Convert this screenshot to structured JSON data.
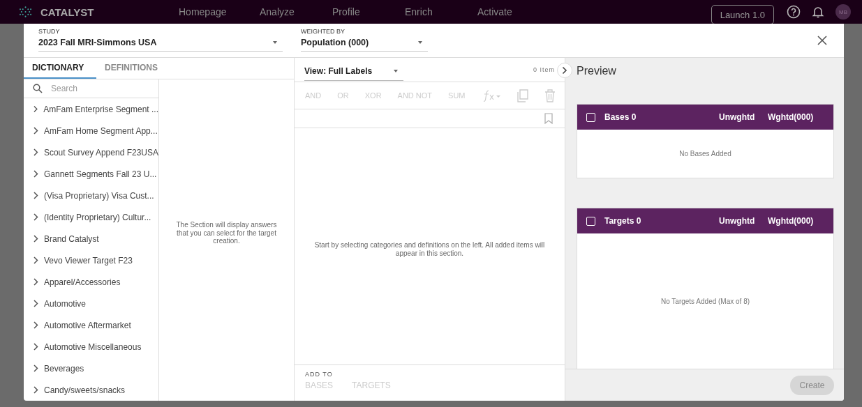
{
  "app": {
    "brand": "CATALYST"
  },
  "nav": [
    {
      "label": "Homepage"
    },
    {
      "label": "Analyze"
    },
    {
      "label": "Profile"
    },
    {
      "label": "Enrich"
    },
    {
      "label": "Activate"
    }
  ],
  "topbar": {
    "launch": "Launch 1.0",
    "avatar": "MB"
  },
  "study": {
    "label": "STUDY",
    "value": "2023 Fall MRI-Simmons USA"
  },
  "weighted_by": {
    "label": "WEIGHTED BY",
    "value": "Population (000)"
  },
  "tabs": [
    {
      "label": "DICTIONARY",
      "selected": true
    },
    {
      "label": "DEFINITIONS",
      "selected": false
    }
  ],
  "search": {
    "placeholder": "Search"
  },
  "categories": [
    {
      "label": "AmFam Enterprise Segment ..."
    },
    {
      "label": "AmFam Home Segment App..."
    },
    {
      "label": "Scout Survey Append F23USA"
    },
    {
      "label": "Gannett Segments Fall 23 U..."
    },
    {
      "label": "(Visa Proprietary) Visa Cust..."
    },
    {
      "label": "(Identity Proprietary) Cultur..."
    },
    {
      "label": "Brand Catalyst"
    },
    {
      "label": "Vevo Viewer Target F23"
    },
    {
      "label": "Apparel/Accessories"
    },
    {
      "label": "Automotive"
    },
    {
      "label": "Automotive Aftermarket"
    },
    {
      "label": "Automotive Miscellaneous"
    },
    {
      "label": "Beverages"
    },
    {
      "label": "Candy/sweets/snacks"
    }
  ],
  "answers_hint": "The Section will display answers that you can select for the target creation.",
  "view": {
    "value": "View: Full Labels",
    "count": "0 Item"
  },
  "operators": [
    {
      "label": "AND",
      "disabled": true
    },
    {
      "label": "OR",
      "disabled": true
    },
    {
      "label": "XOR",
      "disabled": true
    },
    {
      "label": "AND NOT",
      "disabled": true
    },
    {
      "label": "SUM",
      "disabled": true
    }
  ],
  "workspace_hint": "Start by selecting categories and definitions on the left. All added items will appear in this section.",
  "add_to": {
    "label": "ADD TO",
    "buttons": [
      {
        "label": "BASES",
        "disabled": true
      },
      {
        "label": "TARGETS",
        "disabled": true
      }
    ]
  },
  "preview": {
    "title": "Preview",
    "cards": [
      {
        "title": "Bases 0",
        "checked": false,
        "col_1": "Unwghtd",
        "col_2": "Wghtd(000)",
        "empty": "No Bases Added"
      },
      {
        "title": "Targets 0",
        "checked": false,
        "col_1": "Unwghtd",
        "col_2": "Wghtd(000)",
        "empty": "No Targets Added (Max of 8)"
      }
    ],
    "create": {
      "label": "Create",
      "disabled": true
    }
  }
}
